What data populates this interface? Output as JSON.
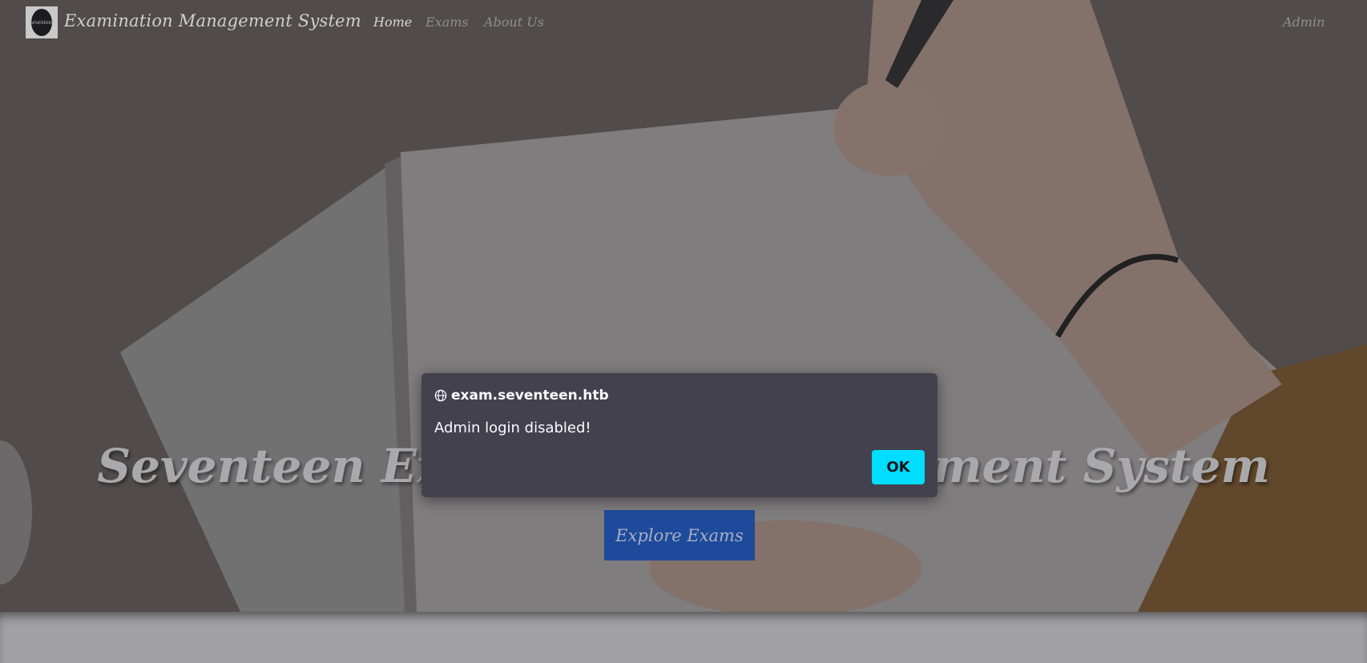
{
  "navbar": {
    "brand": "Examination Management System",
    "logo_text": "Seventeen",
    "links": [
      "Home",
      "Exams",
      "About Us"
    ],
    "admin": "Admin"
  },
  "hero": {
    "title": "Seventeen Examination Management System",
    "button": "Explore Exams"
  },
  "dialog": {
    "origin": "exam.seventeen.htb",
    "message": "Admin login disabled!",
    "ok_label": "OK"
  },
  "colors": {
    "ok_button": "#00ddff",
    "dialog_bg": "#42414d",
    "explore_button": "#1d4a9a"
  }
}
